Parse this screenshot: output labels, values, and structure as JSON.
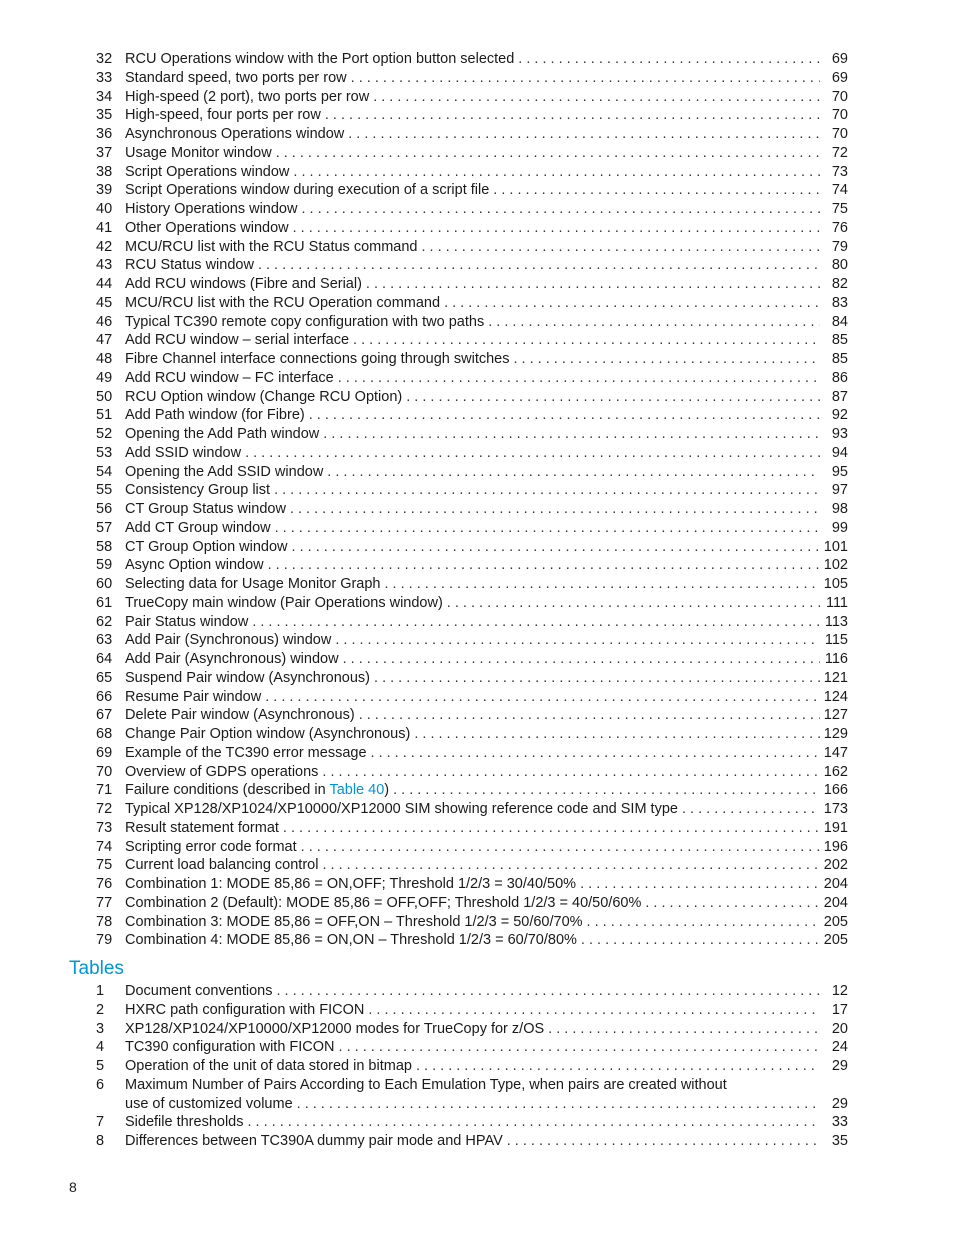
{
  "figures": [
    {
      "num": "32",
      "label": "RCU Operations window with the Port option button selected",
      "page": "69"
    },
    {
      "num": "33",
      "label": "Standard speed, two ports per row",
      "page": "69"
    },
    {
      "num": "34",
      "label": "High-speed (2 port), two ports per row",
      "page": "70"
    },
    {
      "num": "35",
      "label": "High-speed, four ports per row",
      "page": "70"
    },
    {
      "num": "36",
      "label": "Asynchronous Operations window",
      "page": "70"
    },
    {
      "num": "37",
      "label": "Usage Monitor window",
      "page": "72"
    },
    {
      "num": "38",
      "label": "Script Operations window",
      "page": "73"
    },
    {
      "num": "39",
      "label": "Script Operations window during execution of a script file",
      "page": "74"
    },
    {
      "num": "40",
      "label": "History Operations window",
      "page": "75"
    },
    {
      "num": "41",
      "label": "Other Operations window",
      "page": "76"
    },
    {
      "num": "42",
      "label": "MCU/RCU list with the RCU Status command",
      "page": "79"
    },
    {
      "num": "43",
      "label": "RCU Status window",
      "page": "80"
    },
    {
      "num": "44",
      "label": "Add RCU windows (Fibre and Serial)",
      "page": "82"
    },
    {
      "num": "45",
      "label": "MCU/RCU list with the RCU Operation command",
      "page": "83"
    },
    {
      "num": "46",
      "label": "Typical TC390 remote copy configuration with two paths",
      "page": "84"
    },
    {
      "num": "47",
      "label": "Add RCU window – serial interface",
      "page": "85"
    },
    {
      "num": "48",
      "label": "Fibre Channel interface connections going through switches",
      "page": "85"
    },
    {
      "num": "49",
      "label": "Add RCU window – FC interface",
      "page": "86"
    },
    {
      "num": "50",
      "label": "RCU Option window (Change RCU Option)",
      "page": "87"
    },
    {
      "num": "51",
      "label": "Add Path window (for Fibre)",
      "page": "92"
    },
    {
      "num": "52",
      "label": "Opening the Add Path window",
      "page": "93"
    },
    {
      "num": "53",
      "label": "Add SSID window",
      "page": "94"
    },
    {
      "num": "54",
      "label": "Opening the Add SSID window",
      "page": "95"
    },
    {
      "num": "55",
      "label": "Consistency Group list",
      "page": "97"
    },
    {
      "num": "56",
      "label": "CT Group Status window",
      "page": "98"
    },
    {
      "num": "57",
      "label": "Add CT Group window",
      "page": "99"
    },
    {
      "num": "58",
      "label": "CT Group Option window",
      "page": "101"
    },
    {
      "num": "59",
      "label": "Async Option window",
      "page": "102"
    },
    {
      "num": "60",
      "label": "Selecting data for Usage Monitor Graph",
      "page": "105"
    },
    {
      "num": "61",
      "label": "TrueCopy main window (Pair Operations window)",
      "page": "111"
    },
    {
      "num": "62",
      "label": "Pair Status window",
      "page": "113"
    },
    {
      "num": "63",
      "label": "Add Pair (Synchronous) window",
      "page": "115"
    },
    {
      "num": "64",
      "label": "Add Pair (Asynchronous) window",
      "page": "116"
    },
    {
      "num": "65",
      "label": "Suspend Pair window (Asynchronous)",
      "page": "121"
    },
    {
      "num": "66",
      "label": "Resume Pair window",
      "page": "124"
    },
    {
      "num": "67",
      "label": "Delete Pair window (Asynchronous)",
      "page": "127"
    },
    {
      "num": "68",
      "label": "Change Pair Option window (Asynchronous)",
      "page": "129"
    },
    {
      "num": "69",
      "label": "Example of the TC390 error message",
      "page": "147"
    },
    {
      "num": "70",
      "label": "Overview of GDPS operations",
      "page": "162"
    },
    {
      "num": "71",
      "label": "Failure conditions (described in ",
      "link": "Table 40",
      "suffix": ")",
      "page": "166"
    },
    {
      "num": "72",
      "label": "Typical XP128/XP1024/XP10000/XP12000 SIM showing reference code and SIM type",
      "page": "173"
    },
    {
      "num": "73",
      "label": "Result statement format",
      "page": "191"
    },
    {
      "num": "74",
      "label": "Scripting error code format",
      "page": "196"
    },
    {
      "num": "75",
      "label": "Current load balancing control",
      "page": "202"
    },
    {
      "num": "76",
      "label": "Combination 1: MODE 85,86 = ON,OFF; Threshold 1/2/3 = 30/40/50%",
      "page": "204"
    },
    {
      "num": "77",
      "label": "Combination 2 (Default): MODE 85,86 = OFF,OFF; Threshold 1/2/3 = 40/50/60%",
      "page": "204"
    },
    {
      "num": "78",
      "label": "Combination 3: MODE 85,86 = OFF,ON – Threshold 1/2/3 = 50/60/70%",
      "page": "205"
    },
    {
      "num": "79",
      "label": "Combination 4: MODE 85,86 = ON,ON – Threshold 1/2/3 = 60/70/80%",
      "page": "205"
    }
  ],
  "tables_section": {
    "title": "Tables",
    "items": [
      {
        "num": "1",
        "label": "Document conventions",
        "page": "12"
      },
      {
        "num": "2",
        "label": "HXRC path configuration with FICON",
        "page": "17"
      },
      {
        "num": "3",
        "label": "XP128/XP1024/XP10000/XP12000 modes for TrueCopy for z/OS",
        "page": "20"
      },
      {
        "num": "4",
        "label": "TC390 configuration with FICON",
        "page": "24"
      },
      {
        "num": "5",
        "label": "Operation of the unit of data stored in bitmap",
        "page": "29"
      },
      {
        "num": "6",
        "label": "Maximum Number of Pairs According to Each Emulation Type, when pairs are created without",
        "continuation": "use of customized volume",
        "page": "29"
      },
      {
        "num": "7",
        "label": "Sidefile thresholds",
        "page": "33"
      },
      {
        "num": "8",
        "label": "Differences between TC390A dummy pair mode and HPAV",
        "page": "35"
      }
    ]
  },
  "footer": {
    "page_number": "8"
  },
  "colors": {
    "accent": "#0096d6",
    "text": "#1a1a1a"
  }
}
